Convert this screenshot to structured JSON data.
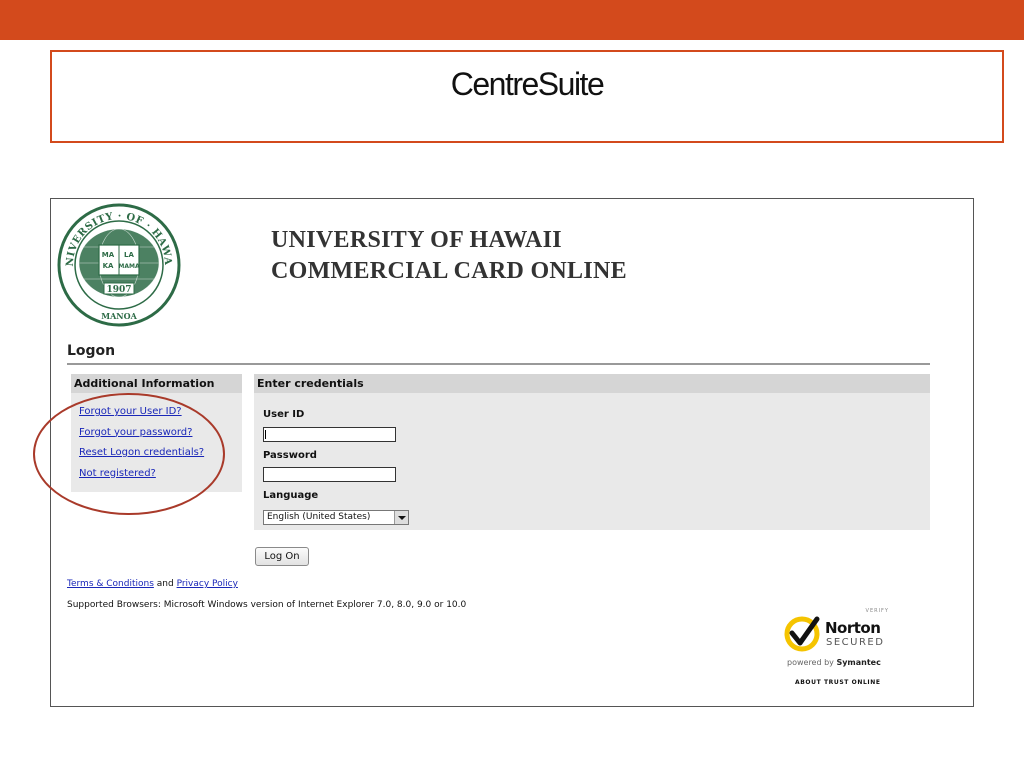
{
  "slide": {
    "title": "CentreSuite"
  },
  "seal": {
    "ring_text": "UNIVERSITY · OF · HAWAII",
    "book_lines": [
      "MA",
      "KA",
      "LA",
      "MAMA"
    ],
    "year": "1907",
    "campus": "MANOA",
    "color": "#2d6b46"
  },
  "heading": {
    "line1": "UNIVERSITY OF HAWAII",
    "line2": "COMMERCIAL CARD ONLINE"
  },
  "logon": {
    "title": "Logon"
  },
  "additional_info": {
    "title": "Additional Information",
    "links": [
      "Forgot your User ID?",
      "Forgot your password?",
      "Reset Logon credentials?",
      "Not registered?"
    ]
  },
  "credentials": {
    "title": "Enter credentials",
    "user_id_label": "User ID",
    "user_id_value": "",
    "password_label": "Password",
    "password_value": "",
    "language_label": "Language",
    "language_value": "English (United States)"
  },
  "logon_button": "Log On",
  "footer": {
    "terms": "Terms & Conditions",
    "and": "and",
    "privacy": "Privacy Policy",
    "browsers": "Supported Browsers: Microsoft Windows version of Internet Explorer 7.0, 8.0, 9.0 or 10.0"
  },
  "norton": {
    "verify": "VERIFY",
    "name": "Norton",
    "secured": "SECURED",
    "powered_by": "powered by",
    "vendor": "Symantec",
    "about": "ABOUT TRUST ONLINE"
  },
  "colors": {
    "accent": "#d34a1c",
    "link": "#1a27b8",
    "panel": "#e9e9e9",
    "panel_header": "#d5d5d5",
    "highlight": "#a93a2a",
    "norton_yellow": "#f5c400"
  }
}
